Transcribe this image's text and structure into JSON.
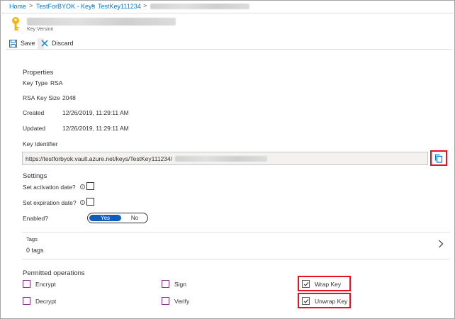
{
  "breadcrumb": {
    "items": [
      "Home",
      "TestForBYOK - Keys",
      "TestKey111234"
    ],
    "separator": ">"
  },
  "header": {
    "subtitle": "Key Version",
    "icon": "key-icon",
    "icon_color": "#f2b707"
  },
  "toolbar": {
    "save_label": "Save",
    "discard_label": "Discard"
  },
  "properties": {
    "title": "Properties",
    "key_type_label": "Key Type",
    "key_type_value": "RSA",
    "key_size_label": "RSA Key Size",
    "key_size_value": "2048",
    "created_label": "Created",
    "created_value": "12/26/2019, 11:29:11 AM",
    "updated_label": "Updated",
    "updated_value": "12/26/2019, 11:29:11 AM",
    "key_identifier_label": "Key Identifier",
    "key_identifier_value": "https://testforbyok.vault.azure.net/keys/TestKey111234/"
  },
  "settings": {
    "title": "Settings",
    "activation_label": "Set activation date?",
    "expiration_label": "Set expiration date?",
    "enabled_label": "Enabled?",
    "toggle_yes": "Yes",
    "toggle_no": "No",
    "enabled": "Yes"
  },
  "tags": {
    "label": "Tags",
    "value": "0 tags"
  },
  "operations": {
    "title": "Permitted operations",
    "items": {
      "encrypt": {
        "label": "Encrypt",
        "checked": false
      },
      "decrypt": {
        "label": "Decrypt",
        "checked": false
      },
      "sign": {
        "label": "Sign",
        "checked": false
      },
      "verify": {
        "label": "Verify",
        "checked": false
      },
      "wrap": {
        "label": "Wrap Key",
        "checked": true
      },
      "unwrap": {
        "label": "Unwrap Key",
        "checked": true
      }
    }
  },
  "colors": {
    "link": "#0078d4",
    "accent": "#0f5dbd",
    "highlight": "#e81123",
    "checkbox_border": "#8a2f8a"
  }
}
